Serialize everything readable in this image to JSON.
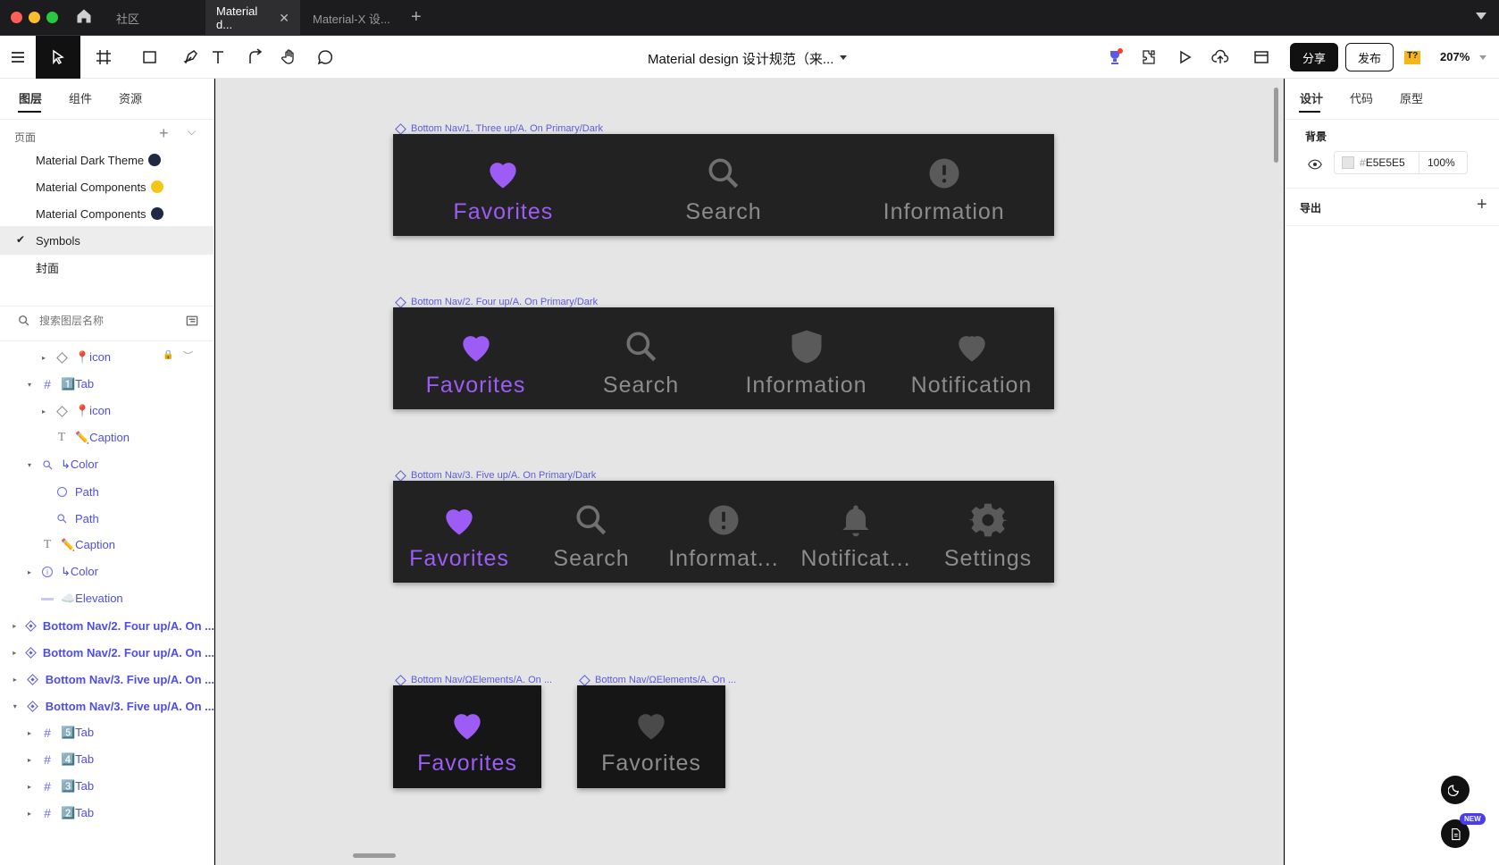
{
  "window": {
    "tabs": [
      {
        "label": "社区"
      },
      {
        "label": "Material d..."
      },
      {
        "label": "Material-X 设..."
      }
    ]
  },
  "toolbar": {
    "doc_title": "Material design 设计规范（来...",
    "share_label": "分享",
    "publish_label": "发布",
    "badge": "T?",
    "zoom": "207%"
  },
  "left_panel": {
    "tabs": [
      "图层",
      "组件",
      "资源"
    ],
    "pages_title": "页面",
    "pages": [
      {
        "label": "Material Dark Theme",
        "dot": "#1e2a44"
      },
      {
        "label": "Material Components",
        "dot": "#f5c518"
      },
      {
        "label": "Material Components",
        "dot": "#1e2a44"
      },
      {
        "label": "Symbols",
        "selected": true
      },
      {
        "label": "封面"
      }
    ],
    "search_placeholder": "搜索图层名称",
    "layers": [
      {
        "name": "📍icon",
        "indent": 2,
        "icon": "component-outline",
        "arrow": "▸",
        "bold": false
      },
      {
        "name": "1️⃣Tab",
        "indent": 1,
        "icon": "frame",
        "arrow": "▾",
        "bold": false
      },
      {
        "name": "📍icon",
        "indent": 2,
        "icon": "component-outline",
        "arrow": "▸",
        "bold": false
      },
      {
        "name": "✏️Caption",
        "indent": 2,
        "icon": "text",
        "arrow": "",
        "bold": false
      },
      {
        "name": "↳Color",
        "indent": 1,
        "icon": "search",
        "arrow": "▾",
        "bold": false
      },
      {
        "name": "Path",
        "indent": 2,
        "icon": "circle",
        "arrow": "",
        "bold": false
      },
      {
        "name": "Path",
        "indent": 2,
        "icon": "search",
        "arrow": "",
        "bold": false
      },
      {
        "name": "✏️Caption",
        "indent": 1,
        "icon": "text",
        "arrow": "",
        "bold": false
      },
      {
        "name": "↳Color",
        "indent": 1,
        "icon": "info",
        "arrow": "▸",
        "bold": false
      },
      {
        "name": "☁️Elevation",
        "indent": 1,
        "icon": "line",
        "arrow": "",
        "bold": false
      },
      {
        "name": "Bottom Nav/2. Four up/A. On ...",
        "indent": 0,
        "icon": "component",
        "arrow": "▸",
        "bold": true
      },
      {
        "name": "Bottom Nav/2. Four up/A. On ...",
        "indent": 0,
        "icon": "component",
        "arrow": "▸",
        "bold": true
      },
      {
        "name": "Bottom Nav/3. Five up/A. On ...",
        "indent": 0,
        "icon": "component",
        "arrow": "▸",
        "bold": true
      },
      {
        "name": "Bottom Nav/3. Five up/A. On ...",
        "indent": 0,
        "icon": "component",
        "arrow": "▾",
        "bold": true
      },
      {
        "name": "5️⃣Tab",
        "indent": 1,
        "icon": "frame",
        "arrow": "▸",
        "bold": false
      },
      {
        "name": "4️⃣Tab",
        "indent": 1,
        "icon": "frame",
        "arrow": "▸",
        "bold": false
      },
      {
        "name": "3️⃣Tab",
        "indent": 1,
        "icon": "frame",
        "arrow": "▸",
        "bold": false
      },
      {
        "name": "2️⃣Tab",
        "indent": 1,
        "icon": "frame",
        "arrow": "▸",
        "bold": false
      }
    ]
  },
  "canvas": {
    "frames": [
      {
        "label": "Bottom Nav/1. Three up/A. On Primary/Dark",
        "items": [
          {
            "label": "Favorites",
            "icon": "heart-icon",
            "active": true
          },
          {
            "label": "Search",
            "icon": "search-icon"
          },
          {
            "label": "Information",
            "icon": "info-icon"
          }
        ]
      },
      {
        "label": "Bottom Nav/2. Four up/A. On Primary/Dark",
        "items": [
          {
            "label": "Favorites",
            "icon": "heart-icon",
            "active": true
          },
          {
            "label": "Search",
            "icon": "search-icon"
          },
          {
            "label": "Information",
            "icon": "shield-icon"
          },
          {
            "label": "Notification",
            "icon": "heart-badge-icon"
          }
        ]
      },
      {
        "label": "Bottom Nav/3. Five up/A. On Primary/Dark",
        "items": [
          {
            "label": "Favorites",
            "icon": "heart-icon",
            "active": true
          },
          {
            "label": "Search",
            "icon": "search-icon"
          },
          {
            "label": "Informat...",
            "icon": "info-icon"
          },
          {
            "label": "Notificat...",
            "icon": "bell-icon"
          },
          {
            "label": "Settings",
            "icon": "gear-icon"
          }
        ]
      }
    ],
    "elements": [
      {
        "label": "Bottom Nav/ΩElements/A. On ...",
        "item": "Favorites",
        "active": true
      },
      {
        "label": "Bottom Nav/ΩElements/A. On ...",
        "item": "Favorites",
        "active": false
      }
    ]
  },
  "right_panel": {
    "tabs": [
      "设计",
      "代码",
      "原型"
    ],
    "background_title": "背景",
    "bg_hex": "E5E5E5",
    "bg_opacity": "100%",
    "export_title": "导出",
    "new_badge": "NEW"
  },
  "colors": {
    "accent_purple": "#9d5cf5",
    "inactive_gray": "#8c8c8c",
    "nav_bg": "#222222",
    "canvas_bg": "#E5E5E5"
  }
}
